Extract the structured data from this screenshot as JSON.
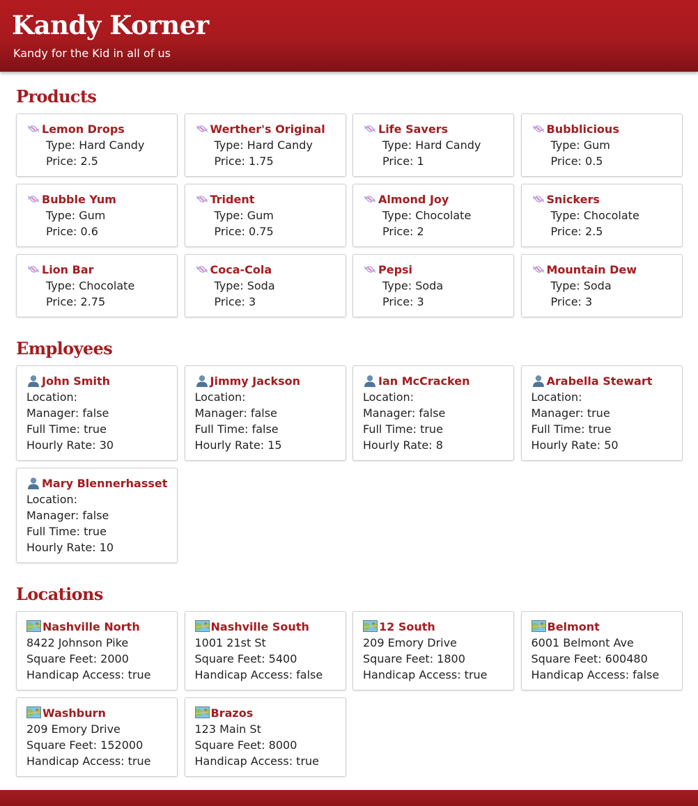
{
  "header": {
    "title": "Kandy Korner",
    "tagline": "Kandy for the Kid in all of us"
  },
  "sections": {
    "products": "Products",
    "employees": "Employees",
    "locations": "Locations"
  },
  "colors": {
    "brand_red": "#a51c20",
    "header_red": "#b31b20",
    "card_border": "#cfcfcf"
  },
  "products": [
    {
      "name": "Lemon Drops",
      "type": "Type: Hard Candy",
      "price": "Price: 2.5"
    },
    {
      "name": "Werther's Original",
      "type": "Type: Hard Candy",
      "price": "Price: 1.75"
    },
    {
      "name": "Life Savers",
      "type": "Type: Hard Candy",
      "price": "Price: 1"
    },
    {
      "name": "Bubblicious",
      "type": "Type: Gum",
      "price": "Price: 0.5"
    },
    {
      "name": "Bubble Yum",
      "type": "Type: Gum",
      "price": "Price: 0.6"
    },
    {
      "name": "Trident",
      "type": "Type: Gum",
      "price": "Price: 0.75"
    },
    {
      "name": "Almond Joy",
      "type": "Type: Chocolate",
      "price": "Price: 2"
    },
    {
      "name": "Snickers",
      "type": "Type: Chocolate",
      "price": "Price: 2.5"
    },
    {
      "name": "Lion Bar",
      "type": "Type: Chocolate",
      "price": "Price: 2.75"
    },
    {
      "name": "Coca-Cola",
      "type": "Type: Soda",
      "price": "Price: 3"
    },
    {
      "name": "Pepsi",
      "type": "Type: Soda",
      "price": "Price: 3"
    },
    {
      "name": "Mountain Dew",
      "type": "Type: Soda",
      "price": "Price: 3"
    }
  ],
  "employees": [
    {
      "name": "John Smith",
      "location": "Location:",
      "manager": "Manager: false",
      "fulltime": "Full Time: true",
      "rate": "Hourly Rate: 30"
    },
    {
      "name": "Jimmy Jackson",
      "location": "Location:",
      "manager": "Manager: false",
      "fulltime": "Full Time: false",
      "rate": "Hourly Rate: 15"
    },
    {
      "name": "Ian McCracken",
      "location": "Location:",
      "manager": "Manager: false",
      "fulltime": "Full Time: true",
      "rate": "Hourly Rate: 8"
    },
    {
      "name": "Arabella Stewart",
      "location": "Location:",
      "manager": "Manager: true",
      "fulltime": "Full Time: true",
      "rate": "Hourly Rate: 50"
    },
    {
      "name": "Mary Blennerhasset",
      "location": "Location:",
      "manager": "Manager: false",
      "fulltime": "Full Time: true",
      "rate": "Hourly Rate: 10"
    }
  ],
  "locations": [
    {
      "name": "Nashville North",
      "address": "8422 Johnson Pike",
      "sqft": "Square Feet: 2000",
      "access": "Handicap Access: true"
    },
    {
      "name": "Nashville South",
      "address": "1001 21st St",
      "sqft": "Square Feet: 5400",
      "access": "Handicap Access: false"
    },
    {
      "name": "12 South",
      "address": "209 Emory Drive",
      "sqft": "Square Feet: 1800",
      "access": "Handicap Access: true"
    },
    {
      "name": "Belmont",
      "address": "6001 Belmont Ave",
      "sqft": "Square Feet: 600480",
      "access": "Handicap Access: false"
    },
    {
      "name": "Washburn",
      "address": "209 Emory Drive",
      "sqft": "Square Feet: 152000",
      "access": "Handicap Access: true"
    },
    {
      "name": "Brazos",
      "address": "123 Main St",
      "sqft": "Square Feet: 8000",
      "access": "Handicap Access: true"
    }
  ],
  "icons": {
    "product": "candy-icon",
    "employee": "person-icon",
    "location": "map-icon"
  }
}
